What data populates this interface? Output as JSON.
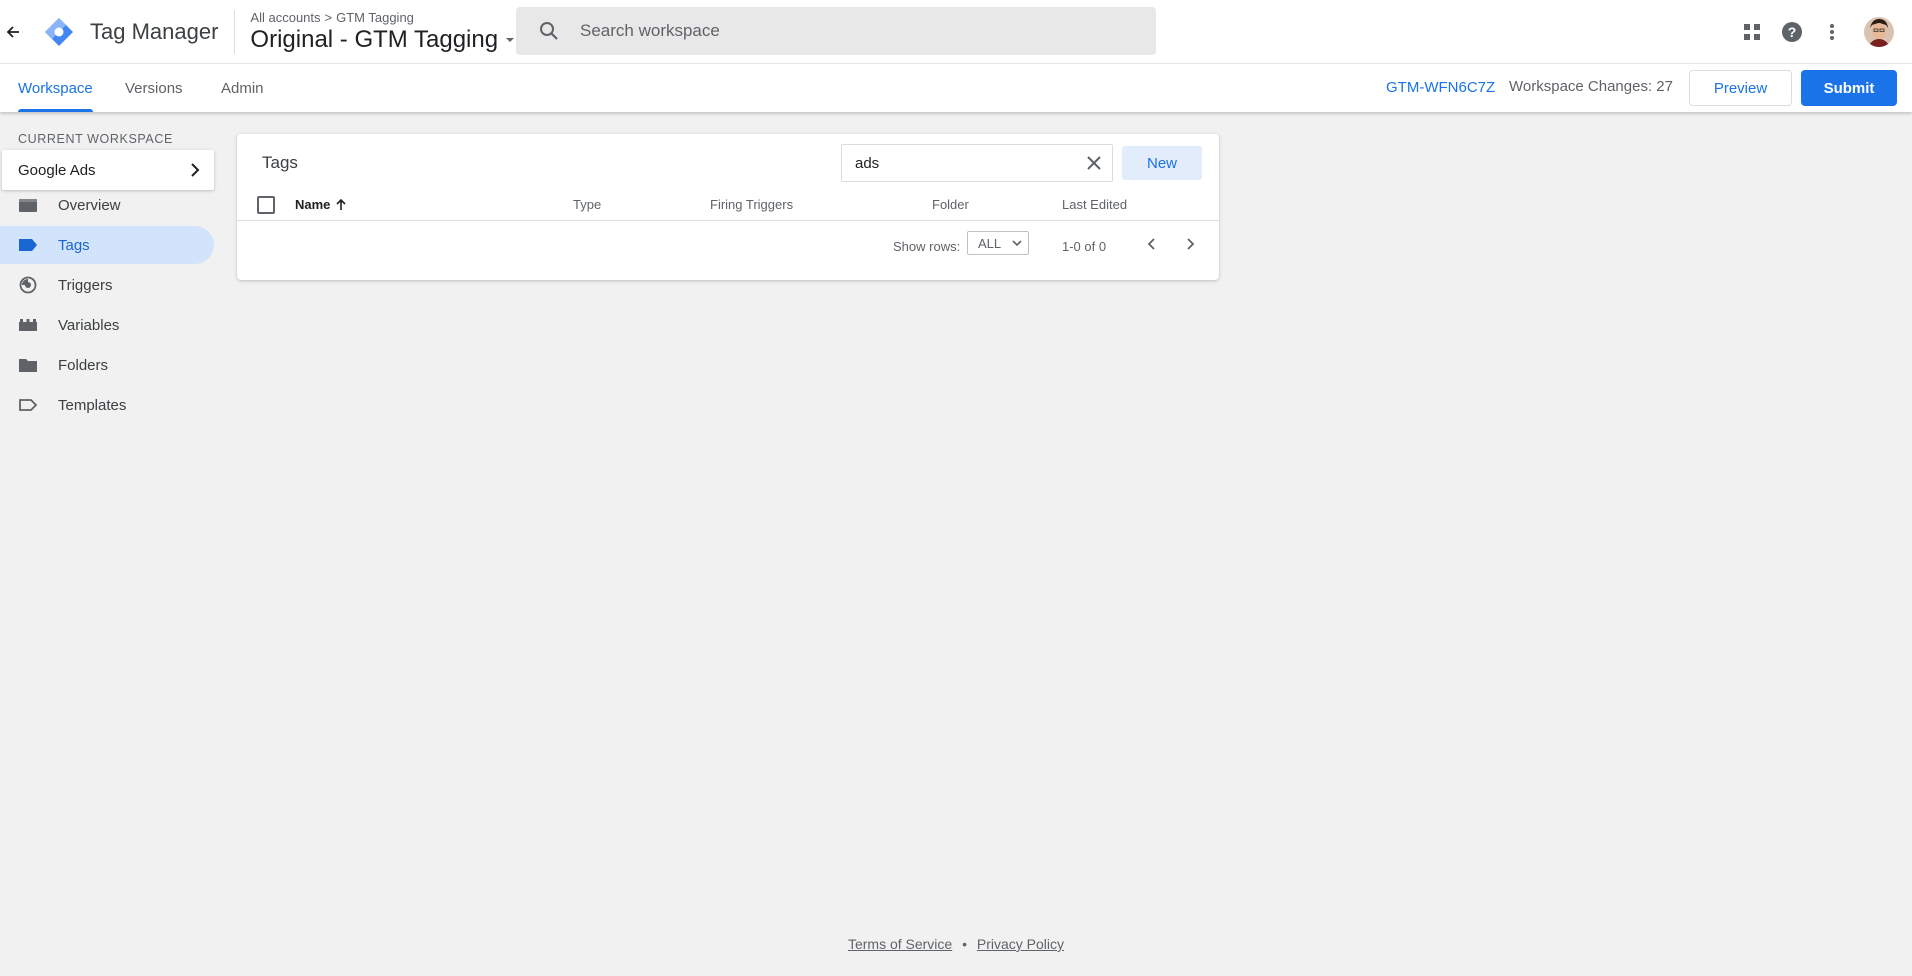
{
  "appbar": {
    "product_name": "Tag Manager",
    "breadcrumb": {
      "accounts": "All accounts",
      "separator": ">",
      "account": "GTM Tagging"
    },
    "container_name": "Original - GTM Tagging",
    "search_placeholder": "Search workspace",
    "icons": [
      "back-arrow-icon",
      "tag-manager-logo",
      "search-icon",
      "apps-grid-icon",
      "help-icon",
      "more-vert-icon"
    ]
  },
  "subbar": {
    "tabs": [
      {
        "label": "Workspace",
        "active": true
      },
      {
        "label": "Versions",
        "active": false
      },
      {
        "label": "Admin",
        "active": false
      }
    ],
    "container_id": "GTM-WFN6C7Z",
    "workspace_changes": "Workspace Changes: 27",
    "preview_label": "Preview",
    "submit_label": "Submit"
  },
  "sidebar": {
    "current_workspace_label": "CURRENT WORKSPACE",
    "current_workspace": "Google Ads",
    "items": [
      {
        "label": "Overview",
        "icon": "overview-icon",
        "active": false
      },
      {
        "label": "Tags",
        "icon": "tag-icon",
        "active": true
      },
      {
        "label": "Triggers",
        "icon": "trigger-icon",
        "active": false
      },
      {
        "label": "Variables",
        "icon": "variables-icon",
        "active": false
      },
      {
        "label": "Folders",
        "icon": "folder-icon",
        "active": false
      },
      {
        "label": "Templates",
        "icon": "template-icon",
        "active": false
      }
    ]
  },
  "tags_card": {
    "title": "Tags",
    "filter_value": "ads",
    "new_label": "New",
    "columns": [
      "Name",
      "Type",
      "Firing Triggers",
      "Folder",
      "Last Edited"
    ],
    "rows": [],
    "show_rows_label": "Show rows:",
    "rows_option": "ALL",
    "range": "1-0 of 0"
  },
  "footer": {
    "terms": "Terms of Service",
    "separator": "•",
    "privacy": "Privacy Policy"
  },
  "colors": {
    "accent": "#1a73e8",
    "active_nav_bg": "#d2e3fc",
    "page_bg": "#f1f1f1"
  }
}
